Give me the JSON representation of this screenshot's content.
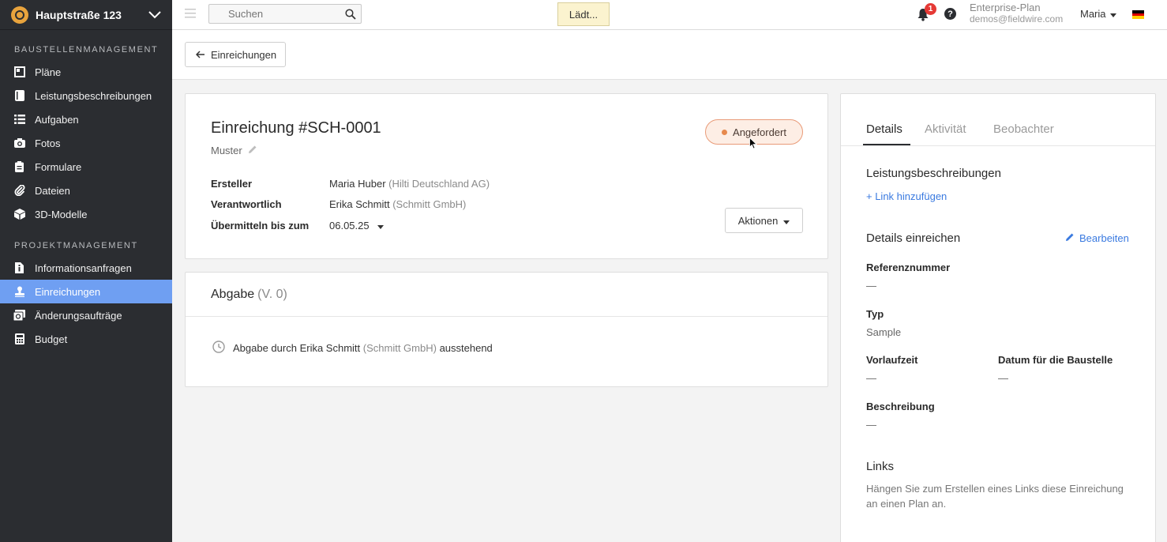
{
  "sidebar": {
    "project_name": "Hauptstraße 123",
    "section_site": "BAUSTELLENMANAGEMENT",
    "site_items": [
      {
        "label": "Pläne",
        "icon": "map-icon"
      },
      {
        "label": "Leistungsbeschreibungen",
        "icon": "book-icon"
      },
      {
        "label": "Aufgaben",
        "icon": "list-icon"
      },
      {
        "label": "Fotos",
        "icon": "camera-icon"
      },
      {
        "label": "Formulare",
        "icon": "clipboard-icon"
      },
      {
        "label": "Dateien",
        "icon": "paperclip-icon"
      },
      {
        "label": "3D-Modelle",
        "icon": "cube-icon"
      }
    ],
    "section_project": "PROJEKTMANAGEMENT",
    "project_items": [
      {
        "label": "Informationsanfragen",
        "icon": "info-doc-icon"
      },
      {
        "label": "Einreichungen",
        "icon": "stamp-icon",
        "active": true
      },
      {
        "label": "Änderungsaufträge",
        "icon": "change-order-icon"
      },
      {
        "label": "Budget",
        "icon": "calculator-icon"
      }
    ]
  },
  "topbar": {
    "search_placeholder": "Suchen",
    "loading_text": "Lädt...",
    "notification_count": "1",
    "help_label": "?",
    "plan_name": "Enterprise-Plan",
    "plan_email": "demos@fieldwire.com",
    "user_name": "Maria"
  },
  "subheader": {
    "back_label": "Einreichungen"
  },
  "submittal": {
    "title": "Einreichung #SCH-0001",
    "subtitle": "Muster",
    "status": "Angefordert",
    "status_color": "#e7894d",
    "creator_label": "Ersteller",
    "creator_name": "Maria Huber",
    "creator_company": "(Hilti Deutschland AG)",
    "responsible_label": "Verantwortlich",
    "responsible_name": "Erika Schmitt",
    "responsible_company": "(Schmitt GmbH)",
    "due_label": "Übermitteln bis zum",
    "due_date": "06.05.25",
    "actions_label": "Aktionen"
  },
  "abgabe": {
    "title": "Abgabe",
    "version": "(V. 0)",
    "row_prefix": "Abgabe durch Erika Schmitt",
    "row_company": "(Schmitt GmbH)",
    "row_suffix": "ausstehend"
  },
  "panel": {
    "tabs": [
      "Details",
      "Aktivität",
      "Beobachter"
    ],
    "active_tab": "Details",
    "specs_title": "Leistungsbeschreibungen",
    "add_link": "+ Link hinzufügen",
    "details_title": "Details einreichen",
    "edit_label": "Bearbeiten",
    "ref_label": "Referenznummer",
    "ref_value": "—",
    "type_label": "Typ",
    "type_value": "Sample",
    "lead_label": "Vorlaufzeit",
    "lead_value": "—",
    "site_date_label": "Datum für die Baustelle",
    "site_date_value": "—",
    "desc_label": "Beschreibung",
    "desc_value": "—",
    "links_title": "Links",
    "links_text": "Hängen Sie zum Erstellen eines Links diese Einreichung an einen Plan an."
  },
  "colors": {
    "sidebar_bg": "#2b2d31",
    "active_nav": "#6f9ff2",
    "link_blue": "#3a7ae0",
    "status_bg": "#fdeee5"
  }
}
